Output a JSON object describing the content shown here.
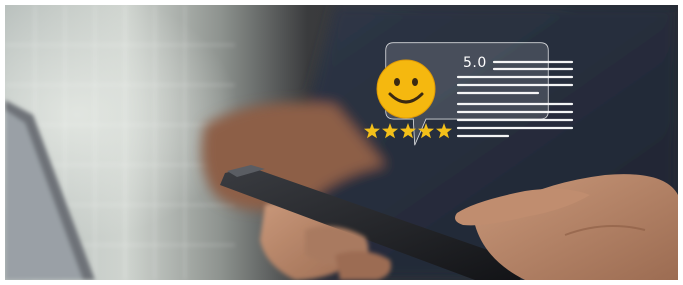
{
  "rating": {
    "score_label": "5.0",
    "stars": 5,
    "max_stars": 5,
    "emoji": "smiley-face-icon"
  },
  "colors": {
    "emoji_yellow": "#f5b80f",
    "star_yellow": "#f3c01a",
    "bubble_fill": "#ffffff",
    "lines": "#ffffff"
  }
}
